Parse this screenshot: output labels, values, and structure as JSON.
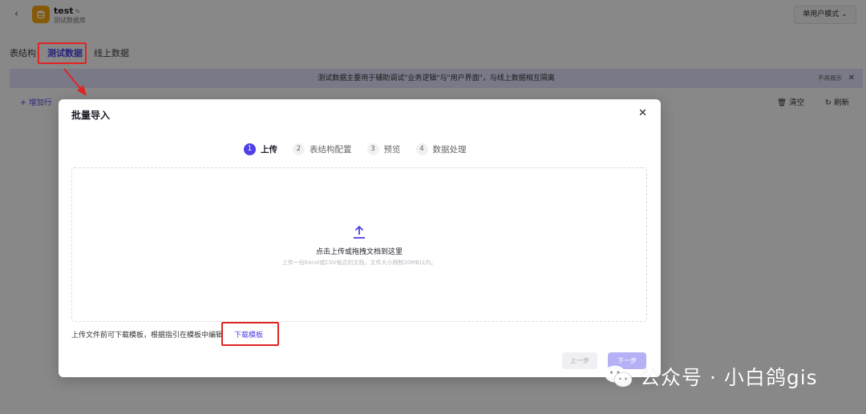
{
  "header": {
    "back_glyph": "‹",
    "app_name": "test",
    "app_subtitle": "测试数据库",
    "mode_label": "单用户模式 ⌄",
    "icons": {
      "logo": "database-icon",
      "edit": "edit-icon",
      "back": "chevron-left-icon"
    }
  },
  "tabs": [
    {
      "label": "表结构",
      "active": false
    },
    {
      "label": "测试数据",
      "active": true
    },
    {
      "label": "线上数据",
      "active": false
    }
  ],
  "notice": {
    "text": "测试数据主要用于辅助调试\"业务逻辑\"与\"用户界面\"，与线上数据相互隔离",
    "hide_label": "不再展示",
    "close_glyph": "✕"
  },
  "actions": {
    "add_row": "+ 增加行",
    "clear": "清空",
    "refresh": "刷新"
  },
  "modal": {
    "title": "批量导入",
    "close_glyph": "✕",
    "steps": [
      {
        "num": "1",
        "label": "上传",
        "active": true
      },
      {
        "num": "2",
        "label": "表结构配置",
        "active": false
      },
      {
        "num": "3",
        "label": "预览",
        "active": false
      },
      {
        "num": "4",
        "label": "数据处理",
        "active": false
      }
    ],
    "upload_title": "点击上传或拖拽文档到这里",
    "upload_hint": "上传一份Excel或CSV格式的文档，文件大小限制20MB以内。",
    "template_text": "上传文件前可下载模板，根据指引在模板中编辑",
    "template_link": "下载模板",
    "prev_label": "上一步",
    "next_label": "下一步"
  },
  "watermark": {
    "text": "公众号 · 小白鸽gis"
  },
  "colors": {
    "accent": "#4e40e5",
    "annotation": "#e02424",
    "logo": "#f2a20a"
  }
}
